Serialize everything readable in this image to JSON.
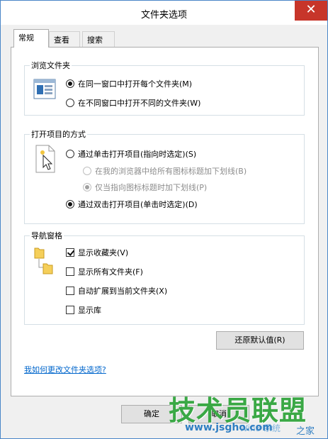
{
  "window": {
    "title": "文件夹选项",
    "close_glyph": "✕"
  },
  "tabs": [
    {
      "label": "常规",
      "active": true
    },
    {
      "label": "查看",
      "active": false
    },
    {
      "label": "搜索",
      "active": false
    }
  ],
  "browse_folders": {
    "title": "浏览文件夹",
    "options": [
      {
        "label": "在同一窗口中打开每个文件夹(M)",
        "selected": true
      },
      {
        "label": "在不同窗口中打开不同的文件夹(W)",
        "selected": false
      }
    ]
  },
  "open_items": {
    "title": "打开项目的方式",
    "options": [
      {
        "label": "通过单击打开项目(指向时选定)(S)",
        "selected": false,
        "enabled": true
      },
      {
        "label": "在我的浏览器中给所有图标标题加下划线(B)",
        "selected": false,
        "enabled": false
      },
      {
        "label": "仅当指向图标标题时加下划线(P)",
        "selected": true,
        "enabled": false
      },
      {
        "label": "通过双击打开项目(单击时选定)(D)",
        "selected": true,
        "enabled": true
      }
    ]
  },
  "nav_pane": {
    "title": "导航窗格",
    "options": [
      {
        "label": "显示收藏夹(V)",
        "checked": true
      },
      {
        "label": "显示所有文件夹(F)",
        "checked": false
      },
      {
        "label": "自动扩展到当前文件夹(X)",
        "checked": false
      },
      {
        "label": "显示库",
        "checked": false
      }
    ]
  },
  "restore_defaults_label": "还原默认值(R)",
  "help_link": "我如何更改文件夹选项?",
  "footer": {
    "ok_label": "确定",
    "cancel_label": "取消"
  },
  "watermark": {
    "brand": "技术员联盟",
    "url": "www.jsgho.com",
    "suffix": "之家",
    "win": "Win8 系统"
  }
}
